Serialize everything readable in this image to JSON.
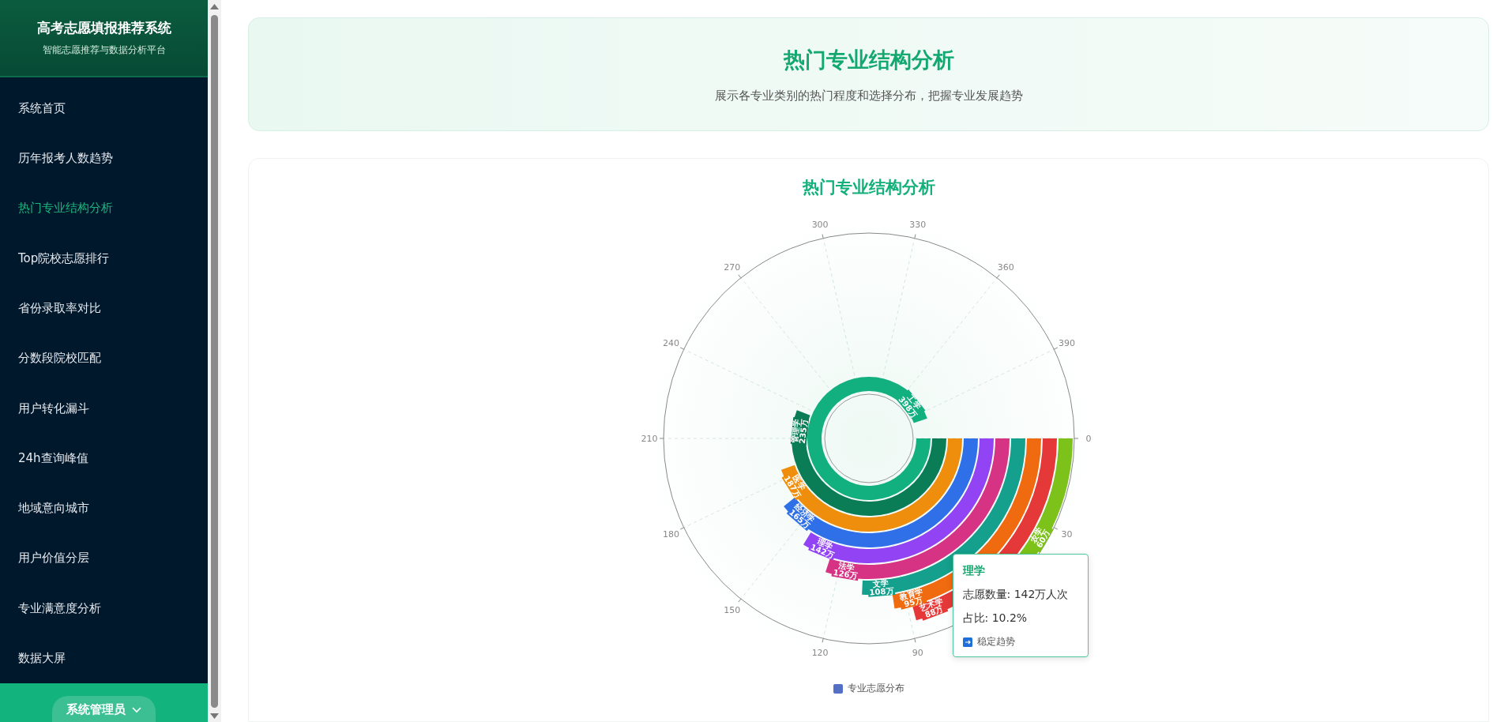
{
  "sidebar": {
    "title": "高考志愿填报推荐系统",
    "subtitle": "智能志愿推荐与数据分析平台",
    "items": [
      {
        "label": "系统首页",
        "selected": false
      },
      {
        "label": "历年报考人数趋势",
        "selected": false
      },
      {
        "label": "热门专业结构分析",
        "selected": true
      },
      {
        "label": "Top院校志愿排行",
        "selected": false
      },
      {
        "label": "省份录取率对比",
        "selected": false
      },
      {
        "label": "分数段院校匹配",
        "selected": false
      },
      {
        "label": "用户转化漏斗",
        "selected": false
      },
      {
        "label": "24h查询峰值",
        "selected": false
      },
      {
        "label": "地域意向城市",
        "selected": false
      },
      {
        "label": "用户价值分层",
        "selected": false
      },
      {
        "label": "专业满意度分析",
        "selected": false
      },
      {
        "label": "数据大屏",
        "selected": false
      }
    ],
    "user": {
      "label": "系统管理员"
    }
  },
  "header": {
    "title": "热门专业结构分析",
    "subtitle": "展示各专业类别的热门程度和选择分布，把握专业发展趋势"
  },
  "chart_card": {
    "title": "热门专业结构分析",
    "angle_ticks": [
      "0",
      "30",
      "90",
      "120",
      "150",
      "180",
      "210",
      "240",
      "270",
      "300",
      "330",
      "360",
      "390"
    ],
    "bars": [
      {
        "name": "工学",
        "label": "398万",
        "color": "#12b07f"
      },
      {
        "name": "管理学",
        "label": "235万",
        "color": "#0a7d57"
      },
      {
        "name": "医学",
        "label": "187万",
        "color": "#ee8e0c"
      },
      {
        "name": "经济学",
        "label": "165万",
        "color": "#2f6fe8"
      },
      {
        "name": "理学",
        "label": "142万",
        "color": "#9244f5"
      },
      {
        "name": "法学",
        "label": "126万",
        "color": "#d63384"
      },
      {
        "name": "文学",
        "label": "108万",
        "color": "#14a08c"
      },
      {
        "name": "教育学",
        "label": "95万",
        "color": "#f06a10"
      },
      {
        "name": "艺术学",
        "label": "88万",
        "color": "#e53838"
      },
      {
        "name": "农学",
        "label": "60万",
        "color": "#7cc21a"
      }
    ],
    "legend": {
      "label": "专业志愿分布",
      "color": "#5470c6"
    },
    "tooltip": {
      "title": "理学",
      "lines": [
        "志愿数量: 142万人次",
        "占比: 10.2%"
      ],
      "trend": "稳定趋势"
    }
  }
}
